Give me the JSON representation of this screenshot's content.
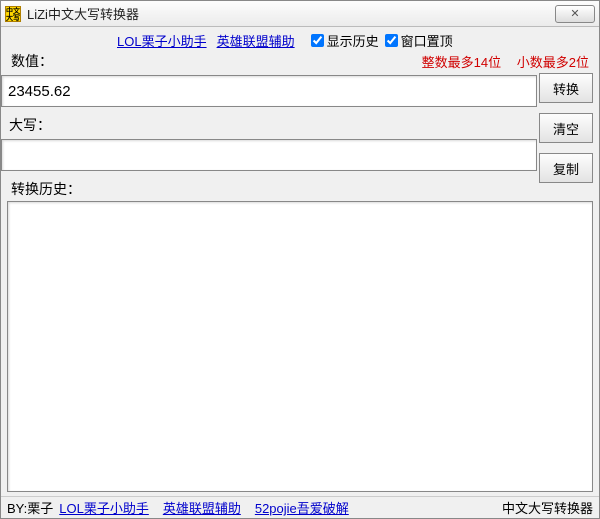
{
  "titlebar": {
    "title": "LiZi中文大写转换器",
    "close": "✕"
  },
  "toprow": {
    "link1": "LOL栗子小助手",
    "link2": "英雄联盟辅助",
    "checkbox1_label": "显示历史",
    "checkbox2_label": "窗口置顶"
  },
  "labels": {
    "value": "数值：",
    "daxie": "大写：",
    "history": "转换历史："
  },
  "hints": {
    "int": "整数最多14位",
    "dec": "小数最多2位"
  },
  "inputs": {
    "value": "23455.62",
    "daxie": ""
  },
  "buttons": {
    "convert": "转换",
    "clear": "清空",
    "copy": "复制"
  },
  "footer": {
    "by": "BY:栗子",
    "link1": "LOL栗子小助手",
    "link2": "英雄联盟辅助",
    "link3": "52pojie吾爱破解",
    "right": "中文大写转换器"
  }
}
